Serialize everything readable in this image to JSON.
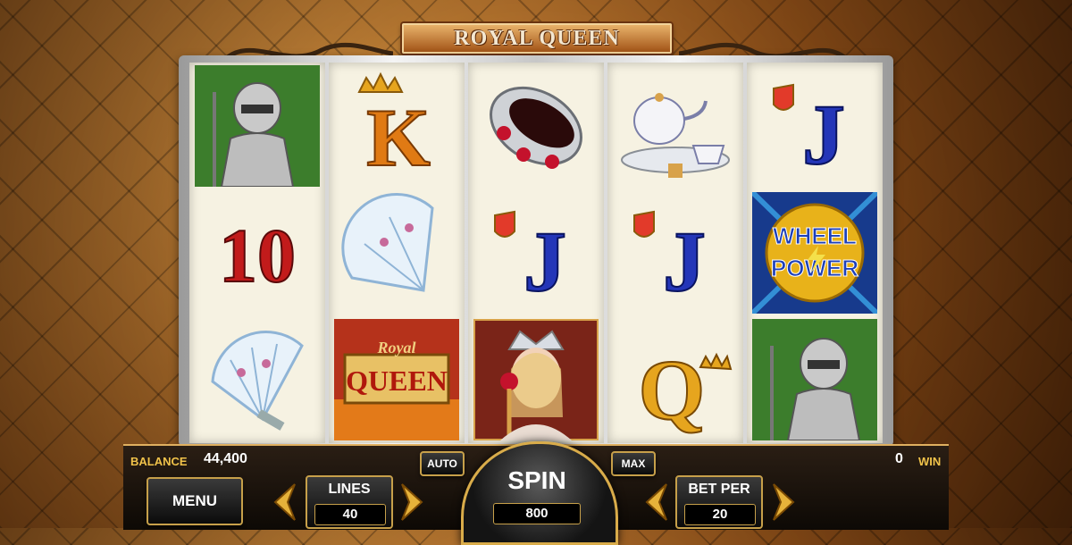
{
  "game": {
    "title": "ROYAL QUEEN"
  },
  "reels": [
    [
      "knight",
      "10",
      "fan"
    ],
    [
      "K",
      "fan",
      "royal-queen-logo"
    ],
    [
      "ring",
      "J",
      "queen"
    ],
    [
      "teapot",
      "J",
      "Q"
    ],
    [
      "J",
      "wheel-power",
      "knight"
    ]
  ],
  "symbols": {
    "ten": "10",
    "king": "K",
    "jack": "J",
    "queen_letter": "Q",
    "wheel_power_line1": "WHEEL",
    "wheel_power_line2": "POWER",
    "logo_line1": "Royal",
    "logo_line2": "QUEEN"
  },
  "hud": {
    "balance_label": "BALANCE",
    "balance_value": "44,400",
    "win_label": "WIN",
    "win_value": "0",
    "menu_label": "MENU",
    "auto_label": "AUTO",
    "max_label": "MAX",
    "lines_label": "LINES",
    "lines_value": "40",
    "spin_label": "SPIN",
    "spin_value": "800",
    "betper_label": "BET PER",
    "betper_value": "20"
  },
  "colors": {
    "gold": "#f0c24a",
    "accent": "#c7a04a",
    "card_red": "#b22222",
    "card_blue": "#2436b8",
    "card_gold": "#e6a51e"
  }
}
